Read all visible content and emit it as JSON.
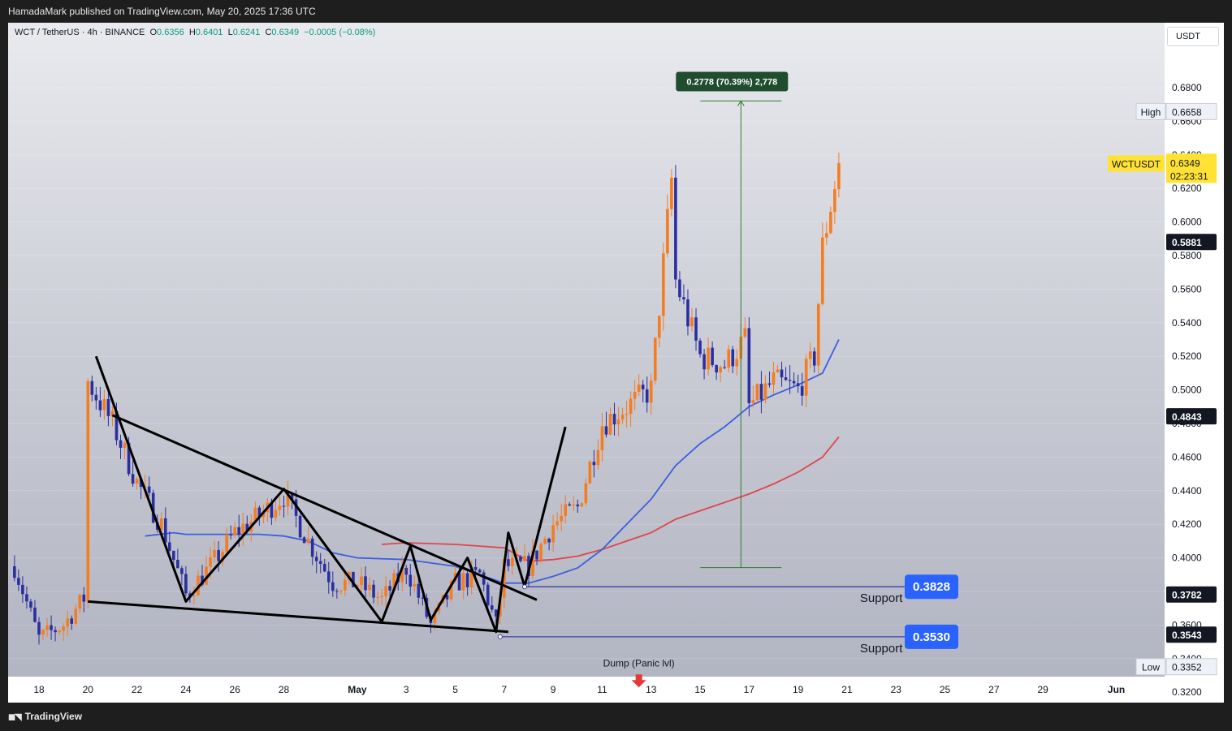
{
  "header": {
    "publisher": "HamadaMark published on TradingView.com, May 20, 2025 17:36 UTC"
  },
  "legend": {
    "symbol": "WCT / TetherUS · 4h · BINANCE",
    "o_label": "O",
    "o": "0.6356",
    "h_label": "H",
    "h": "0.6401",
    "l_label": "L",
    "l": "0.6241",
    "c_label": "C",
    "c": "0.6349",
    "change": "−0.0005 (−0.08%)"
  },
  "currency": "USDT",
  "footer": {
    "logo_text": "TradingView"
  },
  "colors": {
    "up": "#f57c1f",
    "down": "#2b2f9e",
    "ma_fast": "#3d5ee0",
    "ma_slow": "#e0454c",
    "support": "#3f3fa3",
    "accent": "#2962ff",
    "measure": "#2e7d32"
  },
  "chart_data": {
    "type": "candlestick",
    "interval": "4h",
    "ylim": [
      0.31,
      0.7
    ],
    "y_ticks": [
      "0.3200",
      "0.3400",
      "0.3600",
      "0.3800",
      "0.4000",
      "0.4200",
      "0.4400",
      "0.4600",
      "0.4800",
      "0.5000",
      "0.5200",
      "0.5400",
      "0.5600",
      "0.5800",
      "0.6000",
      "0.6200",
      "0.6400",
      "0.6600",
      "0.6800"
    ],
    "x_ticks": [
      {
        "label": "18",
        "date": "2025-04-18"
      },
      {
        "label": "20",
        "date": "2025-04-20"
      },
      {
        "label": "22",
        "date": "2025-04-22"
      },
      {
        "label": "24",
        "date": "2025-04-24"
      },
      {
        "label": "26",
        "date": "2025-04-26"
      },
      {
        "label": "28",
        "date": "2025-04-28"
      },
      {
        "label": "May",
        "date": "2025-05-01"
      },
      {
        "label": "3",
        "date": "2025-05-03"
      },
      {
        "label": "5",
        "date": "2025-05-05"
      },
      {
        "label": "7",
        "date": "2025-05-07"
      },
      {
        "label": "9",
        "date": "2025-05-09"
      },
      {
        "label": "11",
        "date": "2025-05-11"
      },
      {
        "label": "13",
        "date": "2025-05-13"
      },
      {
        "label": "15",
        "date": "2025-05-15"
      },
      {
        "label": "17",
        "date": "2025-05-17"
      },
      {
        "label": "19",
        "date": "2025-05-19"
      },
      {
        "label": "21",
        "date": "2025-05-21"
      },
      {
        "label": "23",
        "date": "2025-05-23"
      },
      {
        "label": "25",
        "date": "2025-05-25"
      },
      {
        "label": "27",
        "date": "2025-05-27"
      },
      {
        "label": "29",
        "date": "2025-05-29"
      },
      {
        "label": "Jun",
        "date": "2025-06-01"
      }
    ],
    "price_path": [
      [
        "2025-04-17",
        0.395
      ],
      [
        "2025-04-18",
        0.352
      ],
      [
        "2025-04-19",
        0.36
      ],
      [
        "2025-04-19T20",
        0.376
      ],
      [
        "2025-04-20",
        0.505
      ],
      [
        "2025-04-21",
        0.48
      ],
      [
        "2025-04-22",
        0.445
      ],
      [
        "2025-04-23",
        0.42
      ],
      [
        "2025-04-24",
        0.378
      ],
      [
        "2025-04-25",
        0.395
      ],
      [
        "2025-04-26",
        0.415
      ],
      [
        "2025-04-27",
        0.425
      ],
      [
        "2025-04-28",
        0.437
      ],
      [
        "2025-04-29",
        0.41
      ],
      [
        "2025-04-30",
        0.385
      ],
      [
        "2025-05-01",
        0.385
      ],
      [
        "2025-05-02",
        0.375
      ],
      [
        "2025-05-03",
        0.394
      ],
      [
        "2025-05-04",
        0.36
      ],
      [
        "2025-05-05",
        0.385
      ],
      [
        "2025-05-06",
        0.39
      ],
      [
        "2025-05-06T16",
        0.36
      ],
      [
        "2025-05-07",
        0.395
      ],
      [
        "2025-05-08",
        0.395
      ],
      [
        "2025-05-09",
        0.42
      ],
      [
        "2025-05-10",
        0.43
      ],
      [
        "2025-05-11",
        0.48
      ],
      [
        "2025-05-12",
        0.49
      ],
      [
        "2025-05-13",
        0.5
      ],
      [
        "2025-05-13T20",
        0.625
      ],
      [
        "2025-05-14",
        0.565
      ],
      [
        "2025-05-15",
        0.52
      ],
      [
        "2025-05-16",
        0.515
      ],
      [
        "2025-05-16T20",
        0.53
      ],
      [
        "2025-05-17",
        0.49
      ],
      [
        "2025-05-18",
        0.505
      ],
      [
        "2025-05-19",
        0.5
      ],
      [
        "2025-05-19T16",
        0.52
      ],
      [
        "2025-05-20",
        0.585
      ],
      [
        "2025-05-20T16",
        0.6349
      ]
    ],
    "ma_fast": {
      "points": [
        [
          "2025-04-22T08",
          0.413
        ],
        [
          "2025-04-23T12",
          0.415
        ],
        [
          "2025-04-24",
          0.414
        ],
        [
          "2025-04-27",
          0.414
        ],
        [
          "2025-04-28",
          0.413
        ],
        [
          "2025-04-29",
          0.41
        ],
        [
          "2025-04-30",
          0.403
        ],
        [
          "2025-05-01",
          0.4
        ],
        [
          "2025-05-03",
          0.399
        ],
        [
          "2025-05-05",
          0.395
        ],
        [
          "2025-05-06",
          0.39
        ],
        [
          "2025-05-07",
          0.385
        ],
        [
          "2025-05-08",
          0.385
        ],
        [
          "2025-05-09",
          0.389
        ],
        [
          "2025-05-10",
          0.394
        ],
        [
          "2025-05-11",
          0.405
        ],
        [
          "2025-05-12",
          0.42
        ],
        [
          "2025-05-13",
          0.435
        ],
        [
          "2025-05-14",
          0.455
        ],
        [
          "2025-05-15",
          0.468
        ],
        [
          "2025-05-16",
          0.478
        ],
        [
          "2025-05-17",
          0.49
        ],
        [
          "2025-05-18",
          0.497
        ],
        [
          "2025-05-19",
          0.503
        ],
        [
          "2025-05-20",
          0.51
        ],
        [
          "2025-05-20T16",
          0.53
        ]
      ]
    },
    "ma_slow": {
      "points": [
        [
          "2025-05-02",
          0.408
        ],
        [
          "2025-05-03",
          0.409
        ],
        [
          "2025-05-05",
          0.408
        ],
        [
          "2025-05-07",
          0.406
        ],
        [
          "2025-05-08",
          0.398
        ],
        [
          "2025-05-09",
          0.399
        ],
        [
          "2025-05-10",
          0.401
        ],
        [
          "2025-05-11",
          0.405
        ],
        [
          "2025-05-12",
          0.41
        ],
        [
          "2025-05-13",
          0.415
        ],
        [
          "2025-05-14",
          0.423
        ],
        [
          "2025-05-15",
          0.428
        ],
        [
          "2025-05-16",
          0.433
        ],
        [
          "2025-05-17",
          0.438
        ],
        [
          "2025-05-18",
          0.444
        ],
        [
          "2025-05-19",
          0.451
        ],
        [
          "2025-05-20",
          0.46
        ],
        [
          "2025-05-20T16",
          0.472
        ]
      ]
    },
    "pattern_lines": [
      {
        "points": [
          [
            "2025-04-20T08",
            0.52
          ],
          [
            "2025-04-24",
            0.374
          ],
          [
            "2025-04-28",
            0.441
          ],
          [
            "2025-05-02",
            0.362
          ],
          [
            "2025-05-03T04",
            0.407
          ],
          [
            "2025-05-04",
            0.363
          ],
          [
            "2025-05-05T12",
            0.4
          ],
          [
            "2025-05-06T16",
            0.356
          ],
          [
            "2025-05-07T04",
            0.415
          ],
          [
            "2025-05-07T20",
            0.383
          ],
          [
            "2025-05-09T12",
            0.478
          ]
        ]
      },
      {
        "points": [
          [
            "2025-04-21",
            0.485
          ],
          [
            "2025-05-08T08",
            0.375
          ]
        ]
      },
      {
        "points": [
          [
            "2025-04-20",
            0.374
          ],
          [
            "2025-05-07T04",
            0.356
          ]
        ]
      }
    ],
    "support_lines": [
      {
        "price": 0.3828,
        "label": "Support",
        "from": "2025-05-07T20",
        "to": "2025-05-24"
      },
      {
        "price": 0.353,
        "label": "Support",
        "from": "2025-05-06T20",
        "to": "2025-05-24"
      }
    ],
    "measure": {
      "from": 0.3942,
      "to": 0.672,
      "x": "2025-05-16T16",
      "label": "0.2778 (70.39%) 2,778"
    },
    "annotations": [
      {
        "text": "Dump (Panic lvl)",
        "date": "2025-05-12T12",
        "price": 0.333,
        "arrow": "down"
      }
    ],
    "price_labels": [
      {
        "text": "0.6349",
        "sub": "02:23:31",
        "tag": "WCTUSDT",
        "value": 0.6349,
        "style": "last"
      },
      {
        "text": "0.6658",
        "tag": "High",
        "value": 0.6658,
        "style": "light"
      },
      {
        "text": "0.5881",
        "value": 0.5881,
        "style": "dark"
      },
      {
        "text": "0.4843",
        "value": 0.4843,
        "style": "dark"
      },
      {
        "text": "0.3782",
        "value": 0.3782,
        "style": "dark"
      },
      {
        "text": "0.3543",
        "value": 0.3543,
        "style": "dark"
      },
      {
        "text": "0.3352",
        "tag": "Low",
        "value": 0.3352,
        "style": "light"
      },
      {
        "text": "0.3828",
        "value": 0.3828,
        "style": "badge"
      },
      {
        "text": "0.3530",
        "value": 0.353,
        "style": "badge"
      }
    ]
  }
}
